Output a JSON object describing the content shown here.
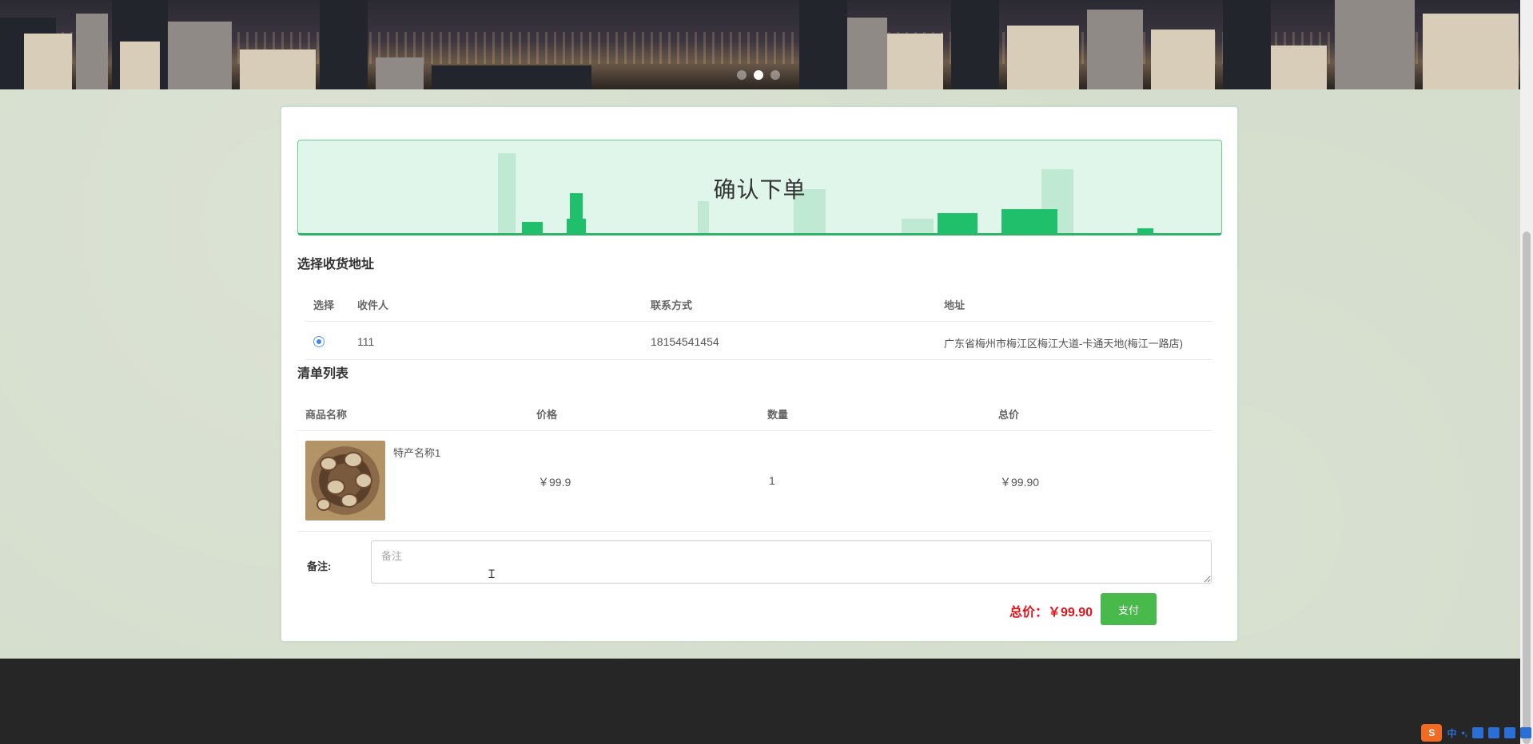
{
  "banner": {
    "carousel_dots": [
      false,
      true,
      false
    ]
  },
  "page_title": "确认下单",
  "address_section": {
    "title": "选择收货地址",
    "headers": {
      "select": "选择",
      "recipient": "收件人",
      "contact": "联系方式",
      "address": "地址"
    },
    "rows": [
      {
        "selected": true,
        "recipient": "111",
        "contact": "18154541454",
        "address": "广东省梅州市梅江区梅江大道-卡通天地(梅江一路店)"
      }
    ]
  },
  "items_section": {
    "title": "清单列表",
    "headers": {
      "name": "商品名称",
      "price": "价格",
      "qty": "数量",
      "total": "总价"
    },
    "rows": [
      {
        "name": "特产名称1",
        "price": "￥99.9",
        "qty": "1",
        "total": "￥99.90",
        "image_icon": "mushroom-product-image"
      }
    ]
  },
  "remark": {
    "label": "备注:",
    "placeholder": "备注",
    "value": ""
  },
  "summary": {
    "total_label": "总价：￥99.90",
    "pay_label": "支付"
  },
  "ime_tray": {
    "logo": "S",
    "lang": "中",
    "punct": "•,"
  }
}
